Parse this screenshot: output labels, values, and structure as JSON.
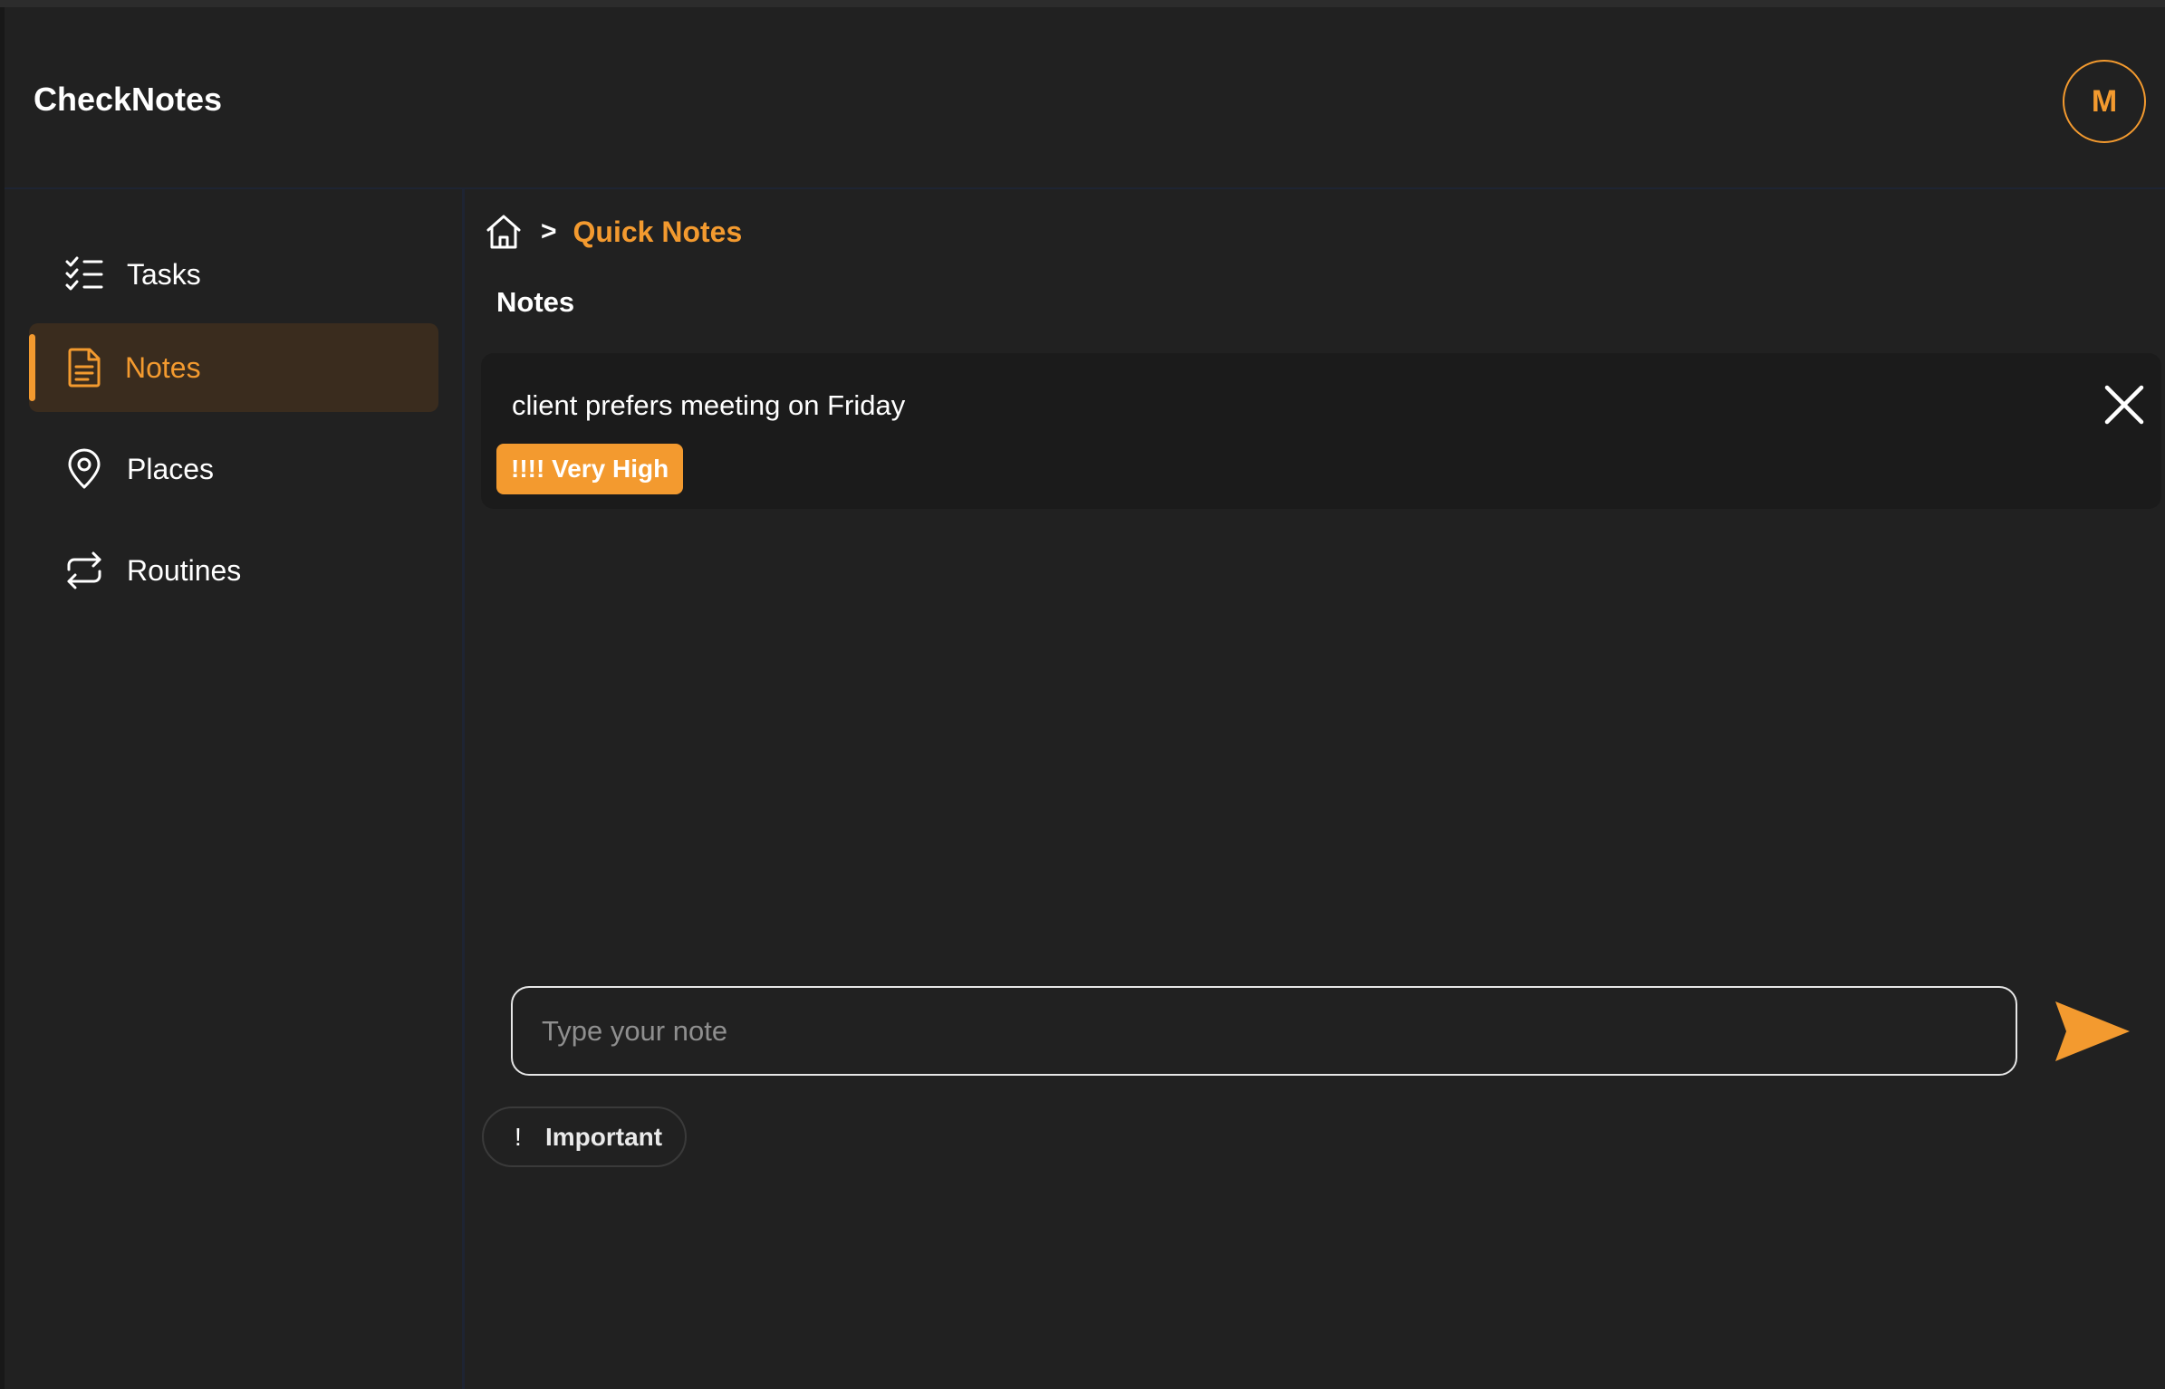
{
  "app": {
    "title": "CheckNotes",
    "avatar_initial": "M"
  },
  "sidebar": {
    "items": [
      {
        "label": "Tasks",
        "icon": "checklist-icon",
        "active": false
      },
      {
        "label": "Notes",
        "icon": "document-icon",
        "active": true
      },
      {
        "label": "Places",
        "icon": "map-pin-icon",
        "active": false
      },
      {
        "label": "Routines",
        "icon": "repeat-icon",
        "active": false
      }
    ]
  },
  "breadcrumb": {
    "home_icon": "home-icon",
    "separator": ">",
    "current": "Quick Notes"
  },
  "main": {
    "section_title": "Notes",
    "notes": [
      {
        "text": "client prefers meeting on Friday",
        "priority": "!!!! Very High"
      }
    ],
    "input": {
      "placeholder": "Type your note",
      "value": ""
    },
    "important_chip": {
      "icon": "!",
      "label": "Important"
    }
  },
  "colors": {
    "accent": "#f39a2f",
    "background": "#212121",
    "card": "#1b1b1b"
  }
}
